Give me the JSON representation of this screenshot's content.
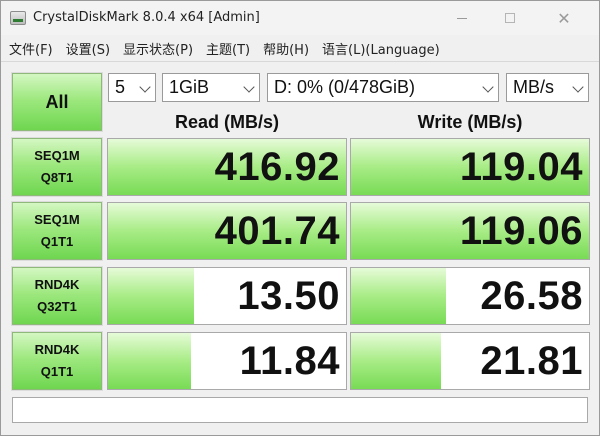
{
  "window": {
    "title": "CrystalDiskMark 8.0.4 x64 [Admin]",
    "close_glyph": "✕"
  },
  "menu": [
    "文件(F)",
    "设置(S)",
    "显示状态(P)",
    "主题(T)",
    "帮助(H)",
    "语言(L)(Language)"
  ],
  "controls": {
    "all_label": "All",
    "count": "5",
    "size": "1GiB",
    "drive": "D: 0% (0/478GiB)",
    "unit": "MB/s"
  },
  "headers": {
    "read": "Read (MB/s)",
    "write": "Write (MB/s)"
  },
  "tests": [
    {
      "line1": "SEQ1M",
      "line2": "Q8T1",
      "read": "416.92",
      "write": "119.04",
      "read_fill": 1.0,
      "write_fill": 1.0
    },
    {
      "line1": "SEQ1M",
      "line2": "Q1T1",
      "read": "401.74",
      "write": "119.06",
      "read_fill": 1.0,
      "write_fill": 1.0
    },
    {
      "line1": "RND4K",
      "line2": "Q32T1",
      "read": "13.50",
      "write": "26.58",
      "read_fill": 0.36,
      "write_fill": 0.4
    },
    {
      "line1": "RND4K",
      "line2": "Q1T1",
      "read": "11.84",
      "write": "21.81",
      "read_fill": 0.35,
      "write_fill": 0.38
    }
  ],
  "comment": ""
}
